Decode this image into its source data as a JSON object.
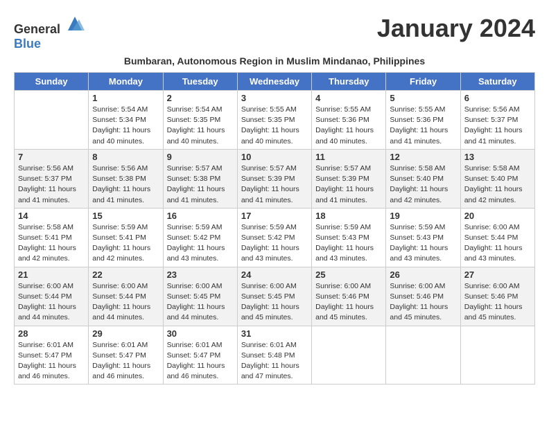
{
  "header": {
    "logo_general": "General",
    "logo_blue": "Blue",
    "month_title": "January 2024",
    "subtitle": "Bumbaran, Autonomous Region in Muslim Mindanao, Philippines"
  },
  "days_of_week": [
    "Sunday",
    "Monday",
    "Tuesday",
    "Wednesday",
    "Thursday",
    "Friday",
    "Saturday"
  ],
  "weeks": [
    [
      {
        "day": "",
        "sunrise": "",
        "sunset": "",
        "daylight": ""
      },
      {
        "day": "1",
        "sunrise": "Sunrise: 5:54 AM",
        "sunset": "Sunset: 5:34 PM",
        "daylight": "Daylight: 11 hours and 40 minutes."
      },
      {
        "day": "2",
        "sunrise": "Sunrise: 5:54 AM",
        "sunset": "Sunset: 5:35 PM",
        "daylight": "Daylight: 11 hours and 40 minutes."
      },
      {
        "day": "3",
        "sunrise": "Sunrise: 5:55 AM",
        "sunset": "Sunset: 5:35 PM",
        "daylight": "Daylight: 11 hours and 40 minutes."
      },
      {
        "day": "4",
        "sunrise": "Sunrise: 5:55 AM",
        "sunset": "Sunset: 5:36 PM",
        "daylight": "Daylight: 11 hours and 40 minutes."
      },
      {
        "day": "5",
        "sunrise": "Sunrise: 5:55 AM",
        "sunset": "Sunset: 5:36 PM",
        "daylight": "Daylight: 11 hours and 41 minutes."
      },
      {
        "day": "6",
        "sunrise": "Sunrise: 5:56 AM",
        "sunset": "Sunset: 5:37 PM",
        "daylight": "Daylight: 11 hours and 41 minutes."
      }
    ],
    [
      {
        "day": "7",
        "sunrise": "Sunrise: 5:56 AM",
        "sunset": "Sunset: 5:37 PM",
        "daylight": "Daylight: 11 hours and 41 minutes."
      },
      {
        "day": "8",
        "sunrise": "Sunrise: 5:56 AM",
        "sunset": "Sunset: 5:38 PM",
        "daylight": "Daylight: 11 hours and 41 minutes."
      },
      {
        "day": "9",
        "sunrise": "Sunrise: 5:57 AM",
        "sunset": "Sunset: 5:38 PM",
        "daylight": "Daylight: 11 hours and 41 minutes."
      },
      {
        "day": "10",
        "sunrise": "Sunrise: 5:57 AM",
        "sunset": "Sunset: 5:39 PM",
        "daylight": "Daylight: 11 hours and 41 minutes."
      },
      {
        "day": "11",
        "sunrise": "Sunrise: 5:57 AM",
        "sunset": "Sunset: 5:39 PM",
        "daylight": "Daylight: 11 hours and 41 minutes."
      },
      {
        "day": "12",
        "sunrise": "Sunrise: 5:58 AM",
        "sunset": "Sunset: 5:40 PM",
        "daylight": "Daylight: 11 hours and 42 minutes."
      },
      {
        "day": "13",
        "sunrise": "Sunrise: 5:58 AM",
        "sunset": "Sunset: 5:40 PM",
        "daylight": "Daylight: 11 hours and 42 minutes."
      }
    ],
    [
      {
        "day": "14",
        "sunrise": "Sunrise: 5:58 AM",
        "sunset": "Sunset: 5:41 PM",
        "daylight": "Daylight: 11 hours and 42 minutes."
      },
      {
        "day": "15",
        "sunrise": "Sunrise: 5:59 AM",
        "sunset": "Sunset: 5:41 PM",
        "daylight": "Daylight: 11 hours and 42 minutes."
      },
      {
        "day": "16",
        "sunrise": "Sunrise: 5:59 AM",
        "sunset": "Sunset: 5:42 PM",
        "daylight": "Daylight: 11 hours and 43 minutes."
      },
      {
        "day": "17",
        "sunrise": "Sunrise: 5:59 AM",
        "sunset": "Sunset: 5:42 PM",
        "daylight": "Daylight: 11 hours and 43 minutes."
      },
      {
        "day": "18",
        "sunrise": "Sunrise: 5:59 AM",
        "sunset": "Sunset: 5:43 PM",
        "daylight": "Daylight: 11 hours and 43 minutes."
      },
      {
        "day": "19",
        "sunrise": "Sunrise: 5:59 AM",
        "sunset": "Sunset: 5:43 PM",
        "daylight": "Daylight: 11 hours and 43 minutes."
      },
      {
        "day": "20",
        "sunrise": "Sunrise: 6:00 AM",
        "sunset": "Sunset: 5:44 PM",
        "daylight": "Daylight: 11 hours and 43 minutes."
      }
    ],
    [
      {
        "day": "21",
        "sunrise": "Sunrise: 6:00 AM",
        "sunset": "Sunset: 5:44 PM",
        "daylight": "Daylight: 11 hours and 44 minutes."
      },
      {
        "day": "22",
        "sunrise": "Sunrise: 6:00 AM",
        "sunset": "Sunset: 5:44 PM",
        "daylight": "Daylight: 11 hours and 44 minutes."
      },
      {
        "day": "23",
        "sunrise": "Sunrise: 6:00 AM",
        "sunset": "Sunset: 5:45 PM",
        "daylight": "Daylight: 11 hours and 44 minutes."
      },
      {
        "day": "24",
        "sunrise": "Sunrise: 6:00 AM",
        "sunset": "Sunset: 5:45 PM",
        "daylight": "Daylight: 11 hours and 45 minutes."
      },
      {
        "day": "25",
        "sunrise": "Sunrise: 6:00 AM",
        "sunset": "Sunset: 5:46 PM",
        "daylight": "Daylight: 11 hours and 45 minutes."
      },
      {
        "day": "26",
        "sunrise": "Sunrise: 6:00 AM",
        "sunset": "Sunset: 5:46 PM",
        "daylight": "Daylight: 11 hours and 45 minutes."
      },
      {
        "day": "27",
        "sunrise": "Sunrise: 6:00 AM",
        "sunset": "Sunset: 5:46 PM",
        "daylight": "Daylight: 11 hours and 45 minutes."
      }
    ],
    [
      {
        "day": "28",
        "sunrise": "Sunrise: 6:01 AM",
        "sunset": "Sunset: 5:47 PM",
        "daylight": "Daylight: 11 hours and 46 minutes."
      },
      {
        "day": "29",
        "sunrise": "Sunrise: 6:01 AM",
        "sunset": "Sunset: 5:47 PM",
        "daylight": "Daylight: 11 hours and 46 minutes."
      },
      {
        "day": "30",
        "sunrise": "Sunrise: 6:01 AM",
        "sunset": "Sunset: 5:47 PM",
        "daylight": "Daylight: 11 hours and 46 minutes."
      },
      {
        "day": "31",
        "sunrise": "Sunrise: 6:01 AM",
        "sunset": "Sunset: 5:48 PM",
        "daylight": "Daylight: 11 hours and 47 minutes."
      },
      {
        "day": "",
        "sunrise": "",
        "sunset": "",
        "daylight": ""
      },
      {
        "day": "",
        "sunrise": "",
        "sunset": "",
        "daylight": ""
      },
      {
        "day": "",
        "sunrise": "",
        "sunset": "",
        "daylight": ""
      }
    ]
  ]
}
